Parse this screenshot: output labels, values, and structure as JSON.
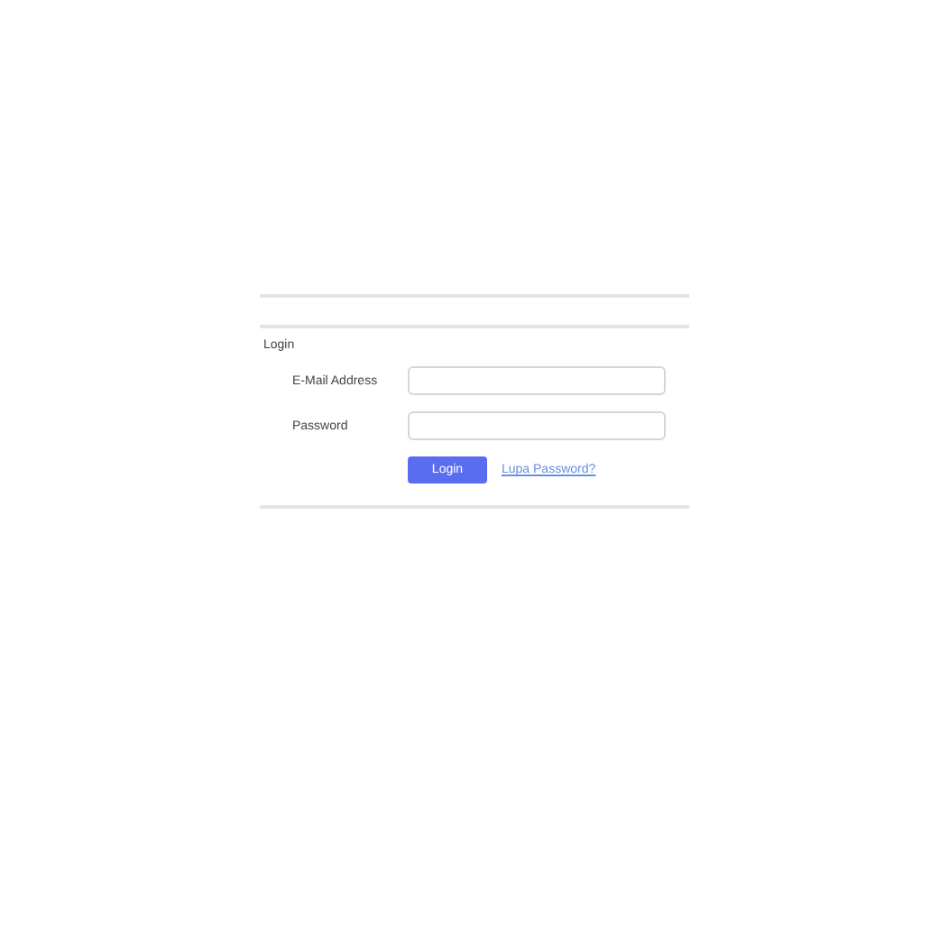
{
  "card": {
    "title": "Login",
    "fields": [
      {
        "label": "E-Mail Address"
      },
      {
        "label": "Password"
      }
    ],
    "login_button": "Login",
    "forgot_link": "Lupa Password?"
  }
}
